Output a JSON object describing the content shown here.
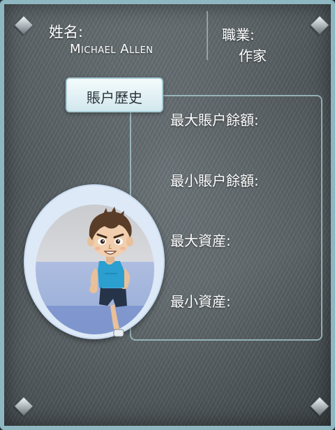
{
  "profile": {
    "name_label": "姓名:",
    "name_value": "Michael Allen",
    "job_label": "職業:",
    "job_value": "作家"
  },
  "history": {
    "tab_label": "賬户歷史",
    "stats": [
      {
        "label": "最大賬户餘額:"
      },
      {
        "label": "最小賬户餘額:"
      },
      {
        "label": "最大資産:"
      },
      {
        "label": "最小資産:"
      }
    ]
  },
  "avatar": {
    "icon": "runner-avatar-icon"
  },
  "colors": {
    "frame": "#8fb7c1",
    "text": "#ffffff",
    "tab_bg": "#e6f3f6",
    "avatar_ring": "#dde9f7",
    "shirt": "#2a9fd0"
  }
}
